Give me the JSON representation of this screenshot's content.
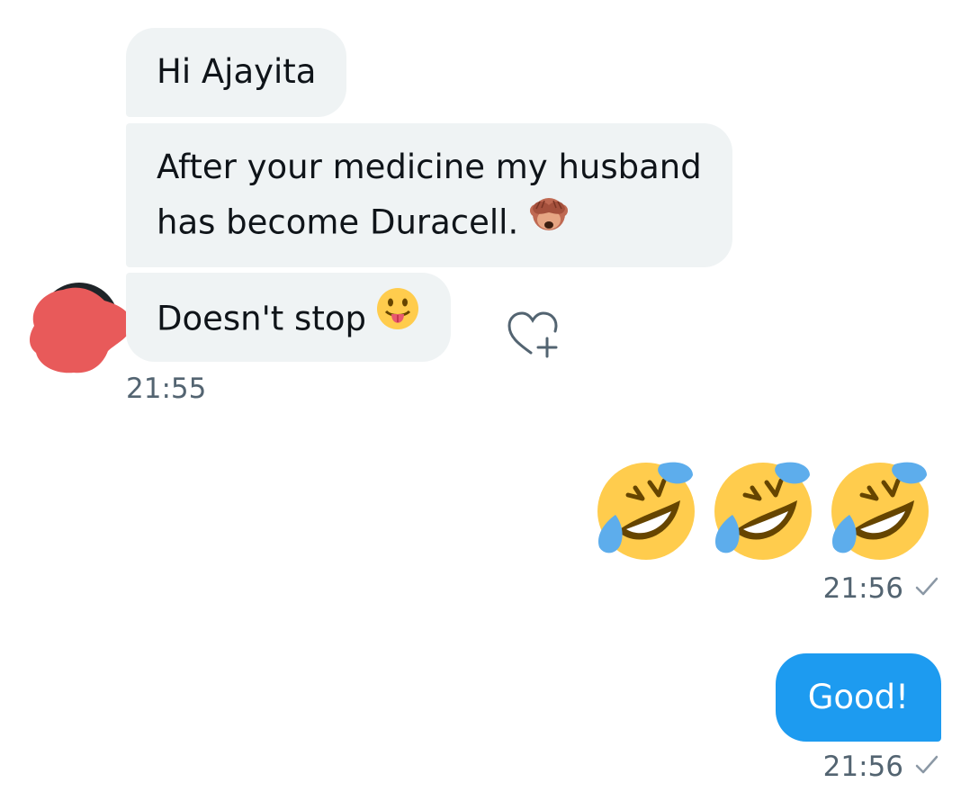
{
  "conversation": {
    "incoming": {
      "messages": [
        {
          "text": "Hi Ajayita"
        },
        {
          "line1": "After your medicine my husband",
          "line2": "has become Duracell.",
          "emoji": "see-no-evil-monkey"
        },
        {
          "text": "Doesn't stop",
          "emoji": "face-with-tongue"
        }
      ],
      "timestamp": "21:55"
    },
    "outgoing": [
      {
        "emojis": [
          "rolling-on-floor-laughing",
          "rolling-on-floor-laughing",
          "rolling-on-floor-laughing"
        ],
        "timestamp": "21:56",
        "status_icon": "checkmark"
      },
      {
        "text": "Good!",
        "timestamp": "21:56",
        "status_icon": "checkmark"
      }
    ]
  },
  "icons": {
    "react": "heart-plus-icon",
    "avatar": "redacted-avatar"
  },
  "colors": {
    "incoming_bubble": "#eff3f4",
    "outgoing_bubble": "#1d9bf0",
    "timestamp": "#536471",
    "avatar_redaction": "#e85a5a"
  }
}
